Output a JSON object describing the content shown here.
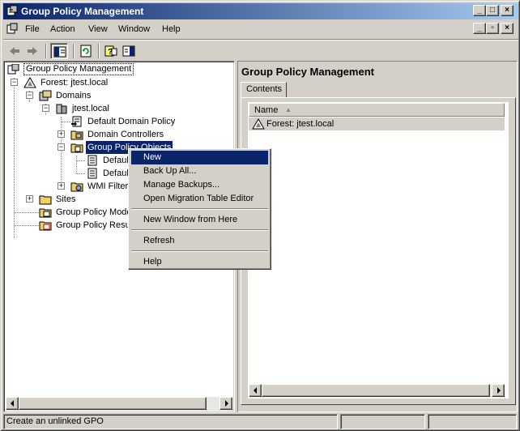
{
  "window": {
    "title": "Group Policy Management"
  },
  "title_buttons": {
    "minimize": "_",
    "maximize": "□",
    "close": "×"
  },
  "menubar": {
    "items": [
      {
        "label": "File"
      },
      {
        "label": "Action"
      },
      {
        "label": "View"
      },
      {
        "label": "Window"
      },
      {
        "label": "Help"
      }
    ]
  },
  "toolbar": {
    "icons": [
      "back-arrow-icon",
      "forward-arrow-icon",
      "show-hide-tree-icon",
      "refresh-icon",
      "help-icon",
      "show-hide-action-pane-icon"
    ]
  },
  "tree": {
    "root": "Group Policy Management",
    "forest": "Forest: jtest.local",
    "domains": "Domains",
    "domain": "jtest.local",
    "default_domain_policy": "Default Domain Policy",
    "domain_controllers": "Domain Controllers",
    "group_policy_objects": "Group Policy Objects",
    "gpo_child_1": "Default",
    "gpo_child_2": "Default",
    "wmi_filters": "WMI Filters",
    "sites": "Sites",
    "modeling": "Group Policy Model",
    "results": "Group Policy Result"
  },
  "right": {
    "heading": "Group Policy Management",
    "tab": "Contents",
    "column_name": "Name",
    "rows": [
      "Forest: jtest.local"
    ]
  },
  "context_menu": {
    "items": [
      "New",
      "Back Up All...",
      "Manage Backups...",
      "Open Migration Table Editor",
      "New Window from Here",
      "Refresh",
      "Help"
    ]
  },
  "status": {
    "text": "Create an unlinked GPO"
  }
}
